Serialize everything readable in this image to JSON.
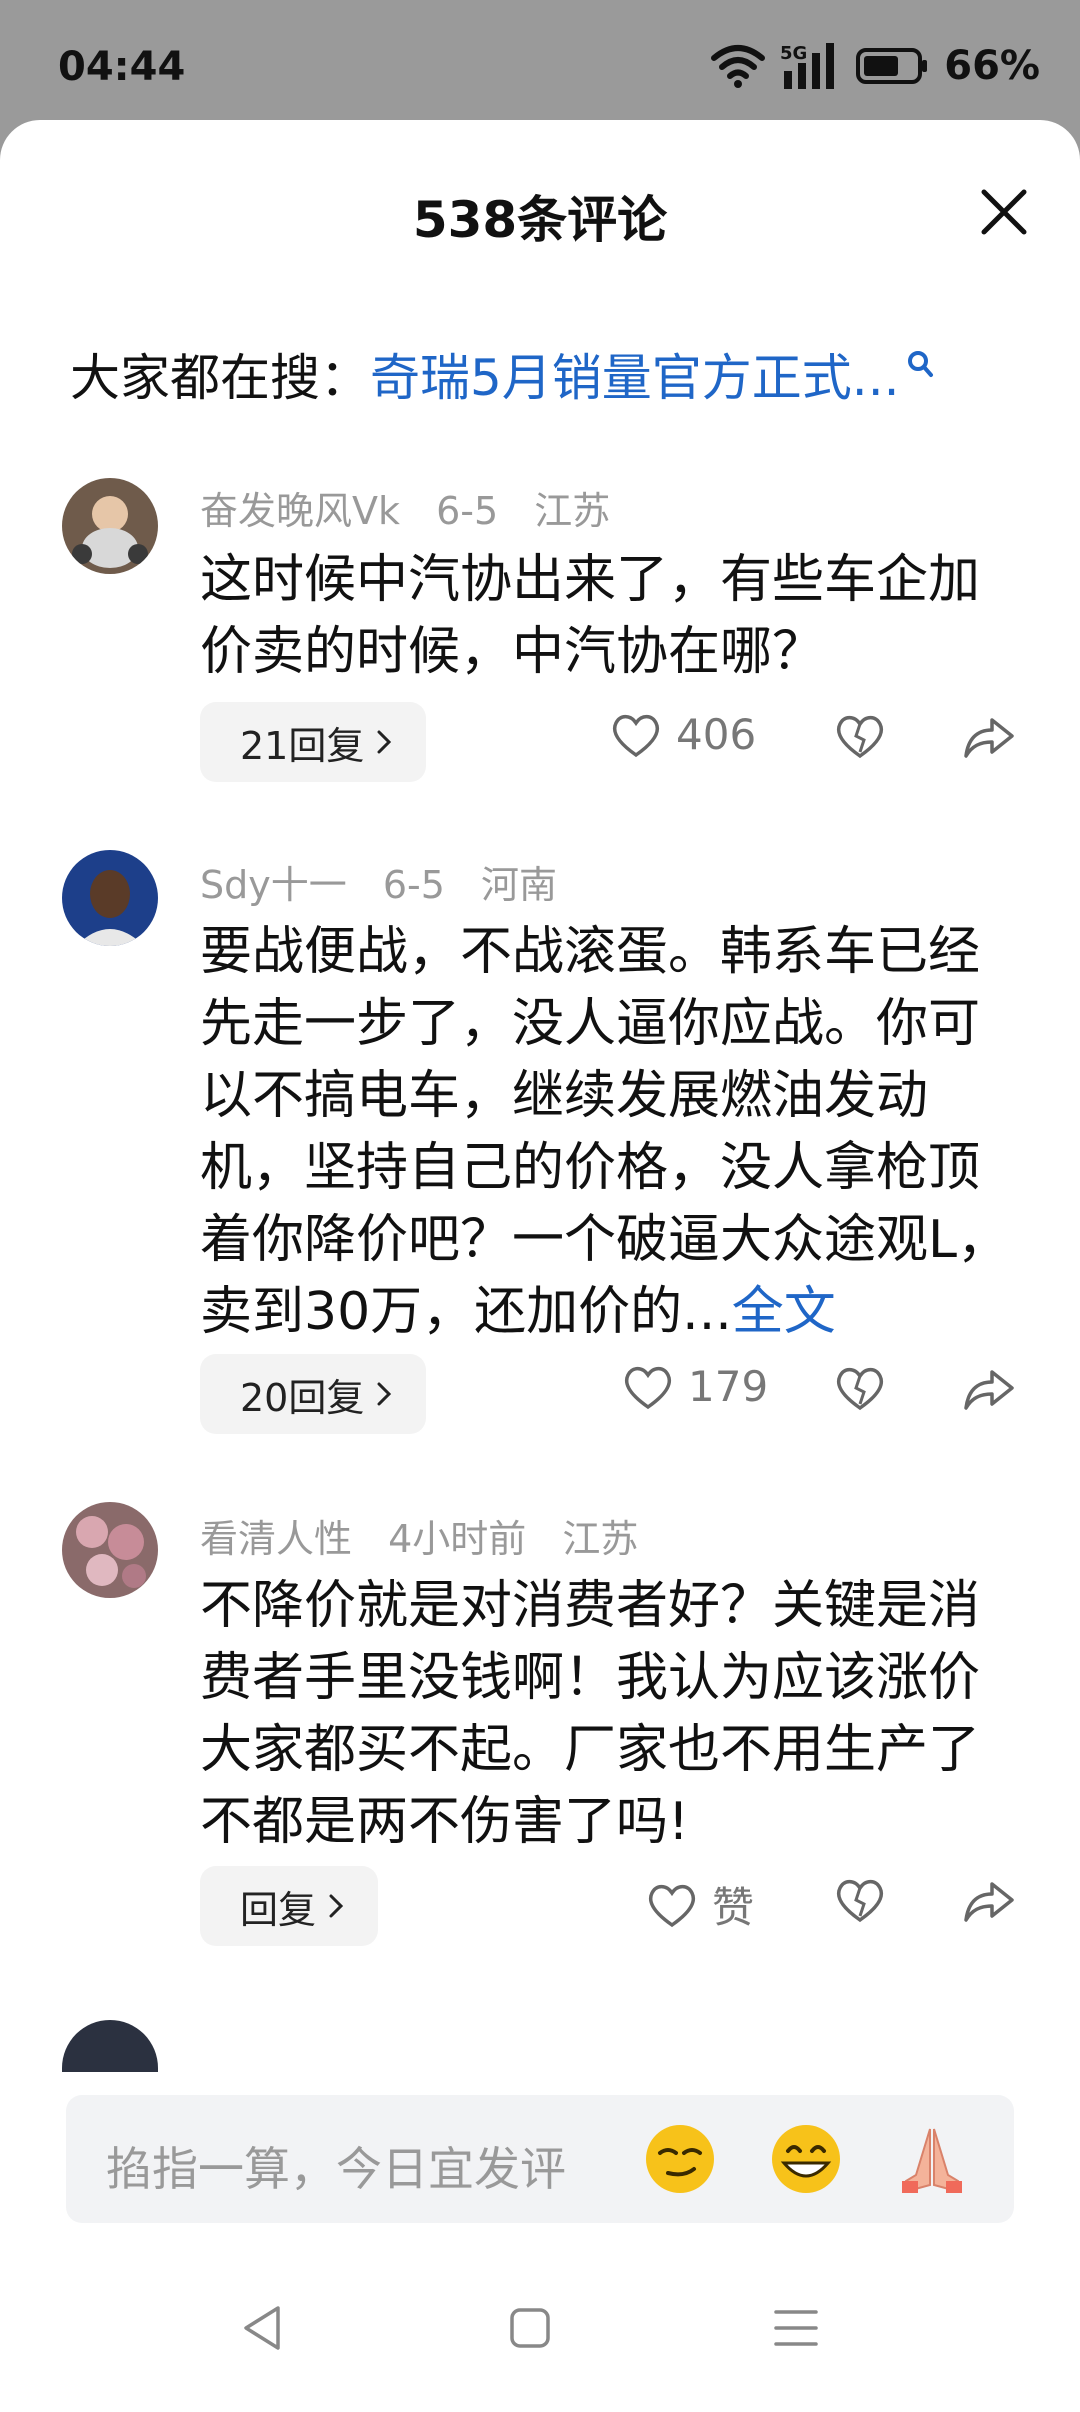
{
  "status": {
    "time": "04:44",
    "network": "5G",
    "battery": "66%"
  },
  "sheet": {
    "title": "538条评论"
  },
  "hot_search": {
    "label": "大家都在搜：",
    "query": "奇瑞5月销量官方正式..."
  },
  "comments": [
    {
      "user": "奋发晚风Vk",
      "date": "6-5",
      "location": "江苏",
      "text": "这时候中汽协出来了，有些车企加价卖的时候，中汽协在哪？",
      "more_link": "",
      "reply_label": "21回复",
      "likes": "406"
    },
    {
      "user": "Sdy十一",
      "date": "6-5",
      "location": "河南",
      "text": "要战便战，不战滚蛋。韩系车已经先走一步了，没人逼你应战。你可以不搞电车，继续发展燃油发动机，坚持自己的价格，没人拿枪顶着你降价吧？一个破逼大众途观L，卖到30万，还加价的...",
      "more_link": "全文",
      "reply_label": "20回复",
      "likes": "179"
    },
    {
      "user": "看清人性",
      "date": "4小时前",
      "location": "江苏",
      "text": "不降价就是对消费者好？关键是消费者手里没钱啊！我认为应该涨价大家都买不起。厂家也不用生产了不都是两不伤害了吗!",
      "more_link": "",
      "reply_label": "回复",
      "likes": "赞"
    }
  ],
  "input": {
    "placeholder": "掐指一算，今日宜发评"
  },
  "emojis": [
    "smirk-emoji",
    "grin-emoji",
    "pray-emoji"
  ],
  "colors": {
    "link": "#1f66c7",
    "meta": "#999999",
    "backdrop": "#9a9a9a"
  }
}
